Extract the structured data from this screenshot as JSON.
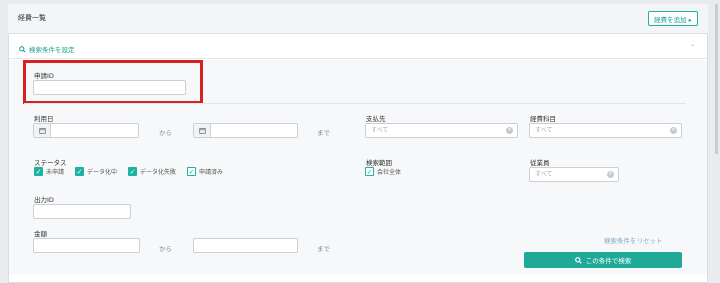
{
  "header": {
    "title": "経費一覧",
    "add_button": "経費を追加 ▸"
  },
  "conditions": {
    "toggle_label": "検索条件を設定",
    "collapse_icon": "chevron-up"
  },
  "fields": {
    "application_id": {
      "label": "申請ID",
      "value": ""
    },
    "usage_date": {
      "label": "利用日",
      "from_text": "から",
      "to_text": "まで"
    },
    "payee": {
      "label": "支払先",
      "placeholder": "すべて"
    },
    "expense_item": {
      "label": "経費科目",
      "placeholder": "すべて"
    },
    "status": {
      "label": "ステータス",
      "options": [
        {
          "label": "未申請",
          "checked": true
        },
        {
          "label": "データ化中",
          "checked": true
        },
        {
          "label": "データ化失敗",
          "checked": true
        },
        {
          "label": "申請済み",
          "checked": false
        }
      ]
    },
    "search_scope": {
      "label": "検索範囲",
      "option_label": "会社全体",
      "checked": false
    },
    "employee": {
      "label": "従業員",
      "placeholder": "すべて"
    },
    "output_id": {
      "label": "出力ID",
      "value": ""
    },
    "amount": {
      "label": "金額",
      "from_text": "から",
      "to_text": "まで"
    }
  },
  "actions": {
    "reset_label": "検索条件をリセット",
    "search_label": "この条件で検索"
  },
  "colors": {
    "accent": "#1faa98",
    "highlight": "#d92020"
  }
}
